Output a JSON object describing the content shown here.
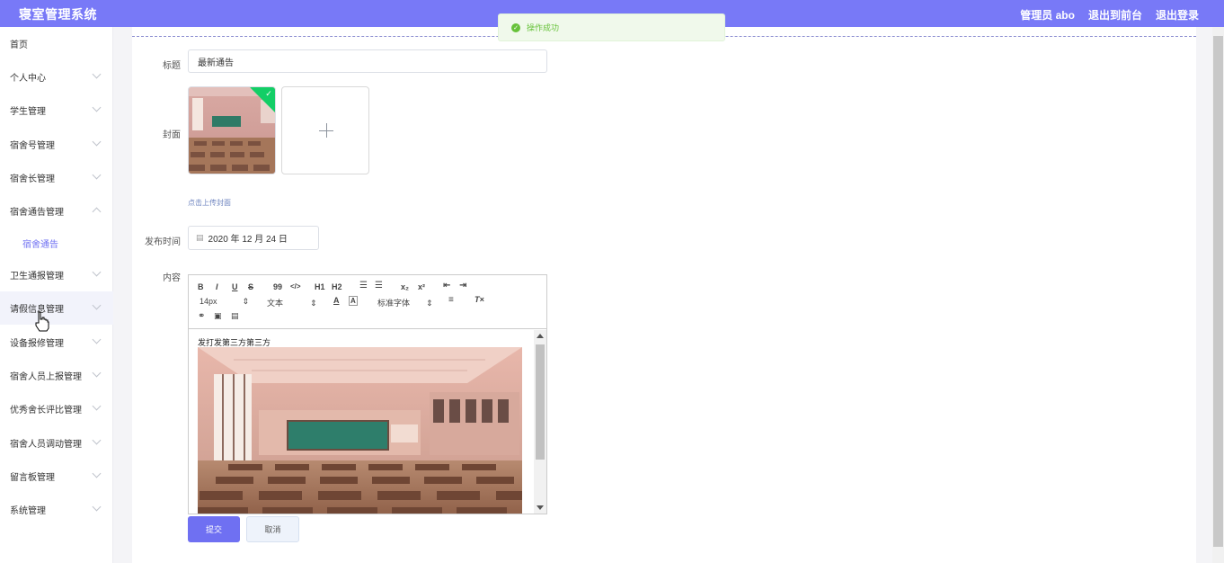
{
  "header": {
    "title": "寝室管理系统",
    "user": "管理员 abo",
    "to_front": "退出到前台",
    "logout": "退出登录"
  },
  "sidebar": {
    "items": [
      {
        "label": "首页",
        "chevron": false
      },
      {
        "label": "个人中心",
        "chevron": true
      },
      {
        "label": "学生管理",
        "chevron": true
      },
      {
        "label": "宿舍号管理",
        "chevron": true
      },
      {
        "label": "宿舍长管理",
        "chevron": true
      },
      {
        "label": "宿舍通告管理",
        "chevron": true,
        "expanded": true
      },
      {
        "label": "卫生通报管理",
        "chevron": true
      },
      {
        "label": "请假信息管理",
        "chevron": true,
        "hovered": true
      },
      {
        "label": "设备报修管理",
        "chevron": true
      },
      {
        "label": "宿舍人员上报管理",
        "chevron": true
      },
      {
        "label": "优秀舍长评比管理",
        "chevron": true
      },
      {
        "label": "宿舍人员调动管理",
        "chevron": true
      },
      {
        "label": "留言板管理",
        "chevron": true
      },
      {
        "label": "系统管理",
        "chevron": true
      }
    ],
    "submenu_label": "宿舍通告"
  },
  "toast": {
    "message": "操作成功",
    "icon": "check-circle-icon",
    "color": "#67c23a"
  },
  "form": {
    "title_label": "标题",
    "title_value": "最新通告",
    "cover_label": "封面",
    "upload_hint": "点击上传封面",
    "date_label": "发布时间",
    "date_value": "2020 年 12 月 24 日",
    "content_label": "内容",
    "content_text": "发打发第三方第三方",
    "submit_label": "提交",
    "cancel_label": "取消"
  },
  "editor_toolbar": {
    "row1": [
      "B",
      "I",
      "U",
      "S",
      "99",
      "</>",
      "H1",
      "H2",
      "ol",
      "ul",
      "x₂",
      "x²",
      "outdent",
      "indent"
    ],
    "font_size": "14px",
    "text_style": "文本",
    "font_family": "标准字体"
  },
  "colors": {
    "header_bg": "#7879f7",
    "accent": "#6f70f2",
    "success": "#67c23a"
  }
}
